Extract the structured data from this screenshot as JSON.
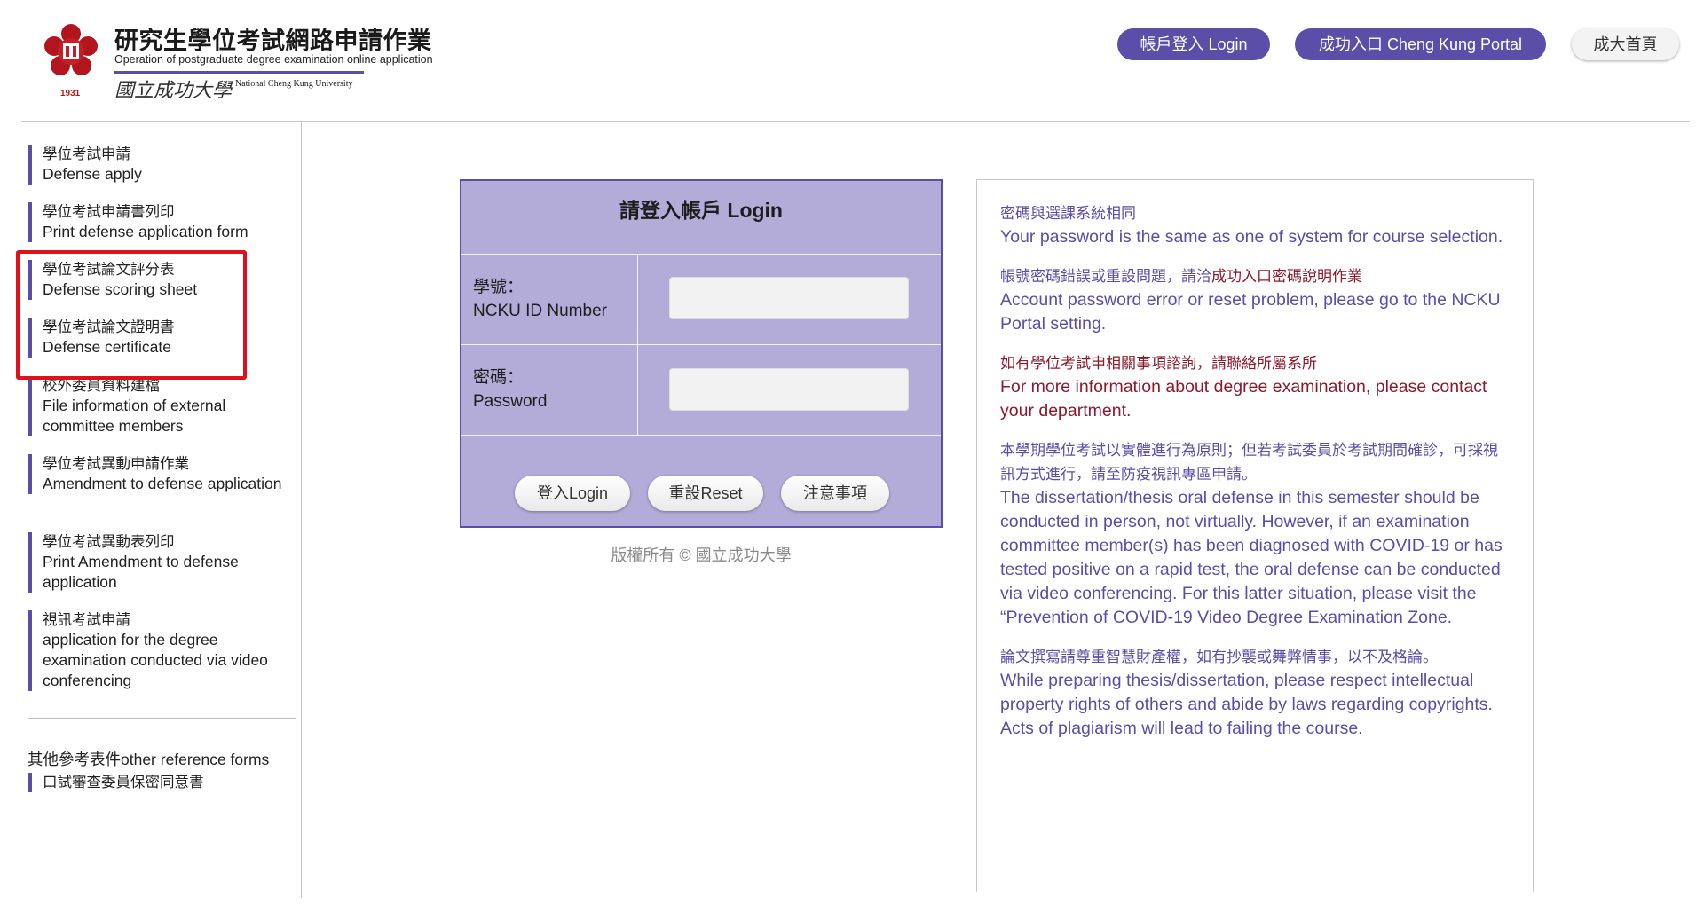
{
  "header": {
    "title_zh": "研究生學位考試網路申請作業",
    "title_en": "Operation of postgraduate degree examination online application",
    "university_zh": "國立成功大學",
    "university_en": "National Cheng Kung University",
    "logo_year": "1931",
    "buttons": {
      "login": "帳戶登入 Login",
      "portal": "成功入口 Cheng Kung Portal",
      "home": "成大首頁"
    }
  },
  "sidebar": {
    "items": [
      {
        "zh": "學位考試申請",
        "en": "Defense apply"
      },
      {
        "zh": "學位考試申請書列印",
        "en": "Print defense application form"
      },
      {
        "zh": "學位考試論文評分表",
        "en": "Defense scoring sheet"
      },
      {
        "zh": "學位考試論文證明書",
        "en": "Defense certificate"
      },
      {
        "zh": "校外委員資料建檔",
        "en": "File information of external committee members"
      },
      {
        "zh": "學位考試異動申請作業",
        "en": "Amendment to defense application"
      },
      {
        "zh": "學位考試異動表列印",
        "en": "Print Amendment to defense application"
      },
      {
        "zh": "視訊考試申請",
        "en": "application for the degree examination conducted via video conferencing"
      }
    ],
    "reference_title": "其他參考表件other reference forms",
    "reference_items": [
      {
        "zh": "口試審查委員保密同意書"
      }
    ]
  },
  "login": {
    "title": "請登入帳戶 Login",
    "id_label_zh": "學號：",
    "id_label_en": "NCKU ID Number",
    "password_label_zh": "密碼：",
    "password_label_en": "Password",
    "id_value": "",
    "password_value": "",
    "buttons": {
      "login": "登入Login",
      "reset": "重設Reset",
      "notes": "注意事項"
    },
    "copyright": "版權所有 © 國立成功大學"
  },
  "info": {
    "p1_zh": "密碼與選課系統相同",
    "p1_en": "Your password is the same as one of system for course selection.",
    "p2_zh_prefix": "帳號密碼錯誤或重設問題，請洽",
    "p2_zh_link": "成功入口密碼說明作業",
    "p2_en": "Account password error or reset problem, please go to the NCKU Portal setting.",
    "p3_zh": "如有學位考試申相關事項諮詢，請聯絡所屬系所",
    "p3_en": "For more information about degree examination, please contact your department.",
    "p4_zh": "本學期學位考試以實體進行為原則；但若考試委員於考試期間確診，可採視訊方式進行，請至防疫視訊專區申請。",
    "p4_en": "The dissertation/thesis oral defense in this semester should be conducted in person, not virtually. However, if an examination committee member(s) has been diagnosed with COVID-19 or has tested positive on a rapid test, the oral defense can be conducted via video conferencing. For this latter situation, please visit the “Prevention of COVID-19 Video Degree Examination Zone.",
    "p5_zh": "論文撰寫請尊重智慧財產權，如有抄襲或舞弊情事，以不及格論。",
    "p5_en_1": "While preparing thesis/dissertation, please respect intellectual property rights of others and abide by laws regarding copyrights.",
    "p5_en_2": "Acts of plagiarism will lead to failing the course."
  },
  "colors": {
    "accent_purple": "#5a4ea8",
    "panel_lavender": "#b3acd8",
    "info_red": "#8b1a2e",
    "highlight_red": "#e0101a"
  },
  "icons": {
    "logo": "ncku-emblem"
  }
}
